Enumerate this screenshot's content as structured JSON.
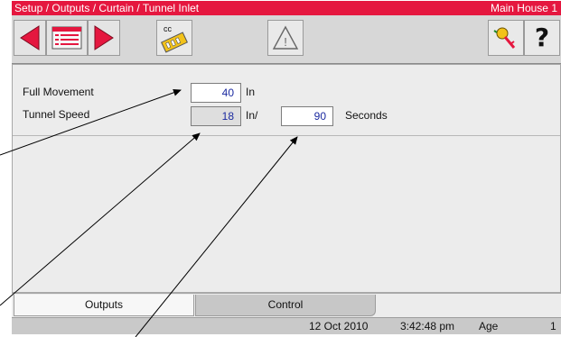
{
  "header": {
    "breadcrumb": "Setup / Outputs / Curtain / Tunnel Inlet",
    "house": "Main House 1"
  },
  "toolbar": {
    "buttons": [
      {
        "icon": "arrow-left-icon"
      },
      {
        "icon": "list-card-icon"
      },
      {
        "icon": "arrow-right-icon"
      },
      {
        "icon": "copy-config-icon",
        "label": "cc"
      },
      {
        "icon": "warning-icon",
        "symbol": "!"
      },
      {
        "icon": "key-icon"
      },
      {
        "icon": "help-icon",
        "label": "?"
      }
    ]
  },
  "form": {
    "full_movement": {
      "label": "Full Movement",
      "value": "40",
      "unit": "In"
    },
    "tunnel_speed": {
      "label": "Tunnel Speed",
      "value": "18",
      "unit": "In/",
      "seconds_value": "90",
      "seconds_unit": "Seconds"
    }
  },
  "tabs": [
    {
      "label": "Outputs",
      "active": true
    },
    {
      "label": "Control",
      "active": false
    }
  ],
  "status": {
    "date": "12 Oct 2010",
    "time": "3:42:48 pm",
    "age_label": "Age",
    "age_value": "1"
  },
  "colors": {
    "title_bar": "#e5173f",
    "arrow_red": "#e5173f",
    "field_text": "#1b2aa0",
    "key_yellow": "#f2c21a"
  }
}
